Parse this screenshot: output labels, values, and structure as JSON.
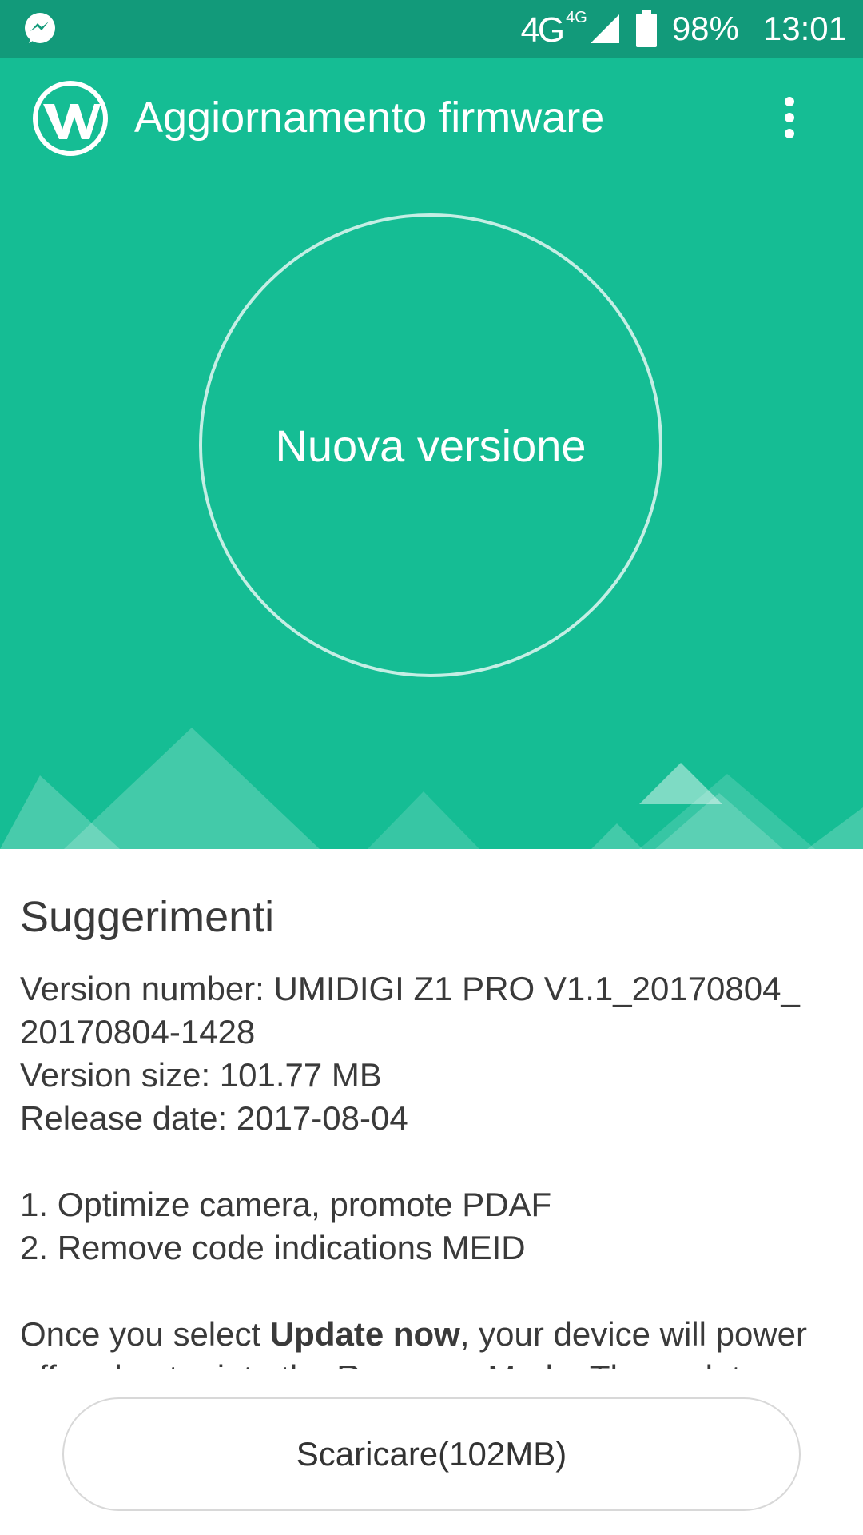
{
  "status_bar": {
    "messenger_icon": "messenger-icon",
    "network": "4G",
    "network_sup": "4G",
    "battery": "98%",
    "time": "13:01"
  },
  "app_bar": {
    "title": "Aggiornamento firmware",
    "logo_icon": "app-logo-icon",
    "menu_icon": "more-vert-icon"
  },
  "hero": {
    "status_text": "Nuova versione"
  },
  "content": {
    "heading": "Suggerimenti",
    "version_number_1": "Version number: UMIDIGI Z1 PRO V1.1_20170804_",
    "version_number_2": "20170804-1428",
    "version_size": "Version size: 101.77 MB",
    "release_date": "Release date: 2017-08-04",
    "note_1": "1. Optimize camera, promote PDAF",
    "note_2": "2. Remove code indications MEID",
    "instruction_prefix": "Once you select ",
    "instruction_bold": "Update now",
    "instruction_suffix": ", your device will power",
    "instruction_line2": "off and enter into the Recovery Mode. The update"
  },
  "download_button": {
    "label": "Scaricare(102MB)"
  },
  "colors": {
    "status_bar": "#129a7a",
    "hero": "#15bd94",
    "text": "#3a3a3a"
  }
}
